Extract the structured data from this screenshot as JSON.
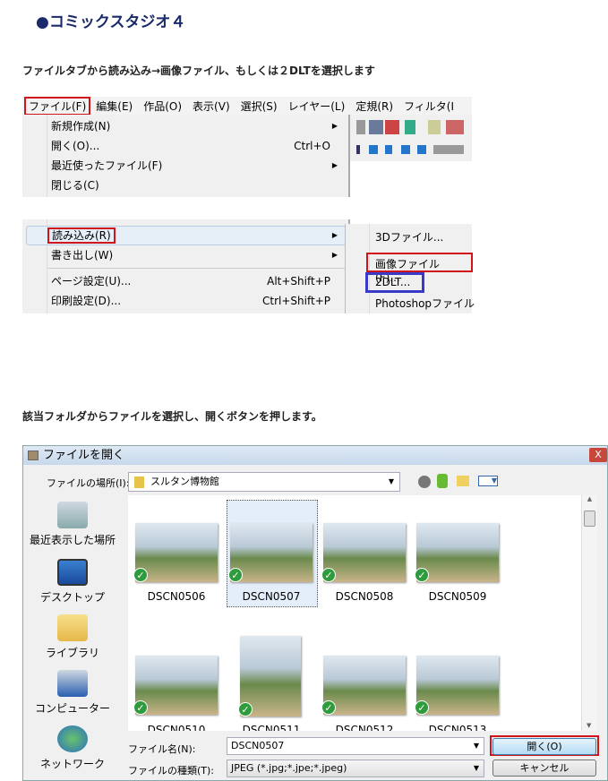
{
  "heading": "●コミックスタジオ４",
  "instruction1": "ファイルタブから読み込み→画像ファイル、もしくは２DLTを選択します",
  "instruction2": "該当フォルダからファイルを選択し、開くボタンを押します。",
  "menubar": [
    "ファイル(F)",
    "編集(E)",
    "作品(O)",
    "表示(V)",
    "選択(S)",
    "レイヤー(L)",
    "定規(R)",
    "フィルタ(I"
  ],
  "file_menu_top": [
    {
      "label": "新規作成(N)",
      "shortcut": "",
      "submenu": true
    },
    {
      "label": "開く(O)...",
      "shortcut": "Ctrl+O",
      "submenu": false
    },
    {
      "label": "最近使ったファイル(F)",
      "shortcut": "",
      "submenu": true
    },
    {
      "label": "閉じる(C)",
      "shortcut": "",
      "submenu": false
    }
  ],
  "file_menu_bottom": [
    {
      "label": "読み込み(R)",
      "shortcut": "",
      "submenu": true
    },
    {
      "label": "書き出し(W)",
      "shortcut": "",
      "submenu": true
    },
    {
      "label": "ページ設定(U)...",
      "shortcut": "Alt+Shift+P",
      "submenu": false
    },
    {
      "label": "印刷設定(D)...",
      "shortcut": "Ctrl+Shift+P",
      "submenu": false
    }
  ],
  "import_submenu": [
    "3Dファイル...",
    "画像ファイル(F)...",
    "2DLT...",
    "Photoshopファイル"
  ],
  "highlight_colors": {
    "red": "#d0141a",
    "blue": "#3a3ac8"
  },
  "dialog": {
    "title": "ファイルを開く",
    "close": "X",
    "location_label": "ファイルの場所(I):",
    "location_value": "スルタン博物館",
    "places": [
      "最近表示した場所",
      "デスクトップ",
      "ライブラリ",
      "コンピューター",
      "ネットワーク"
    ],
    "files": [
      "DSCN0506",
      "DSCN0507",
      "DSCN0508",
      "DSCN0509",
      "DSCN0510",
      "DSCN0511",
      "DSCN0512",
      "DSCN0513"
    ],
    "selected_file": "DSCN0507",
    "filename_label": "ファイル名(N):",
    "filename_value": "DSCN0507",
    "filetype_label": "ファイルの種類(T):",
    "filetype_value": "JPEG (*.jpg;*.jpe;*.jpeg)",
    "open_button": "開く(O)",
    "cancel_button": "キャンセル"
  }
}
